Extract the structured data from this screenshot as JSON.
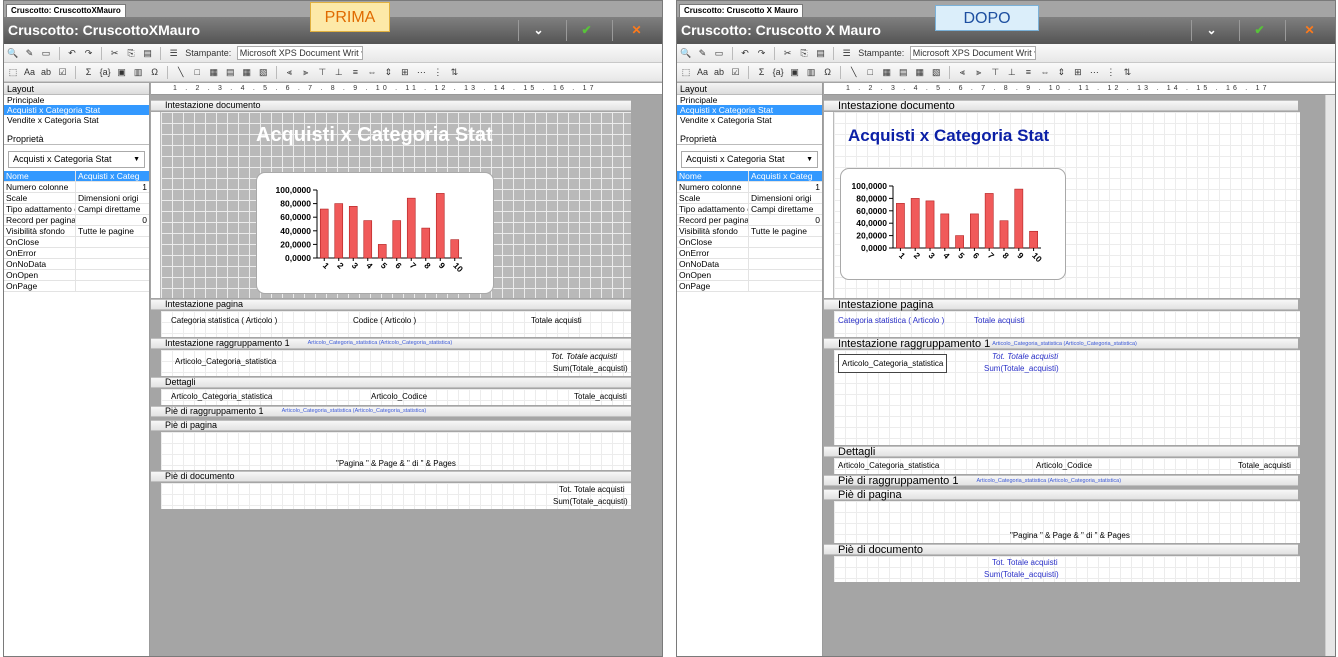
{
  "before": {
    "tab": "Cruscotto: CruscottoXMauro",
    "title": "Cruscotto: CruscottoXMauro",
    "annotation": "PRIMA",
    "printer_label": "Stampante:",
    "printer_value": "Microsoft XPS Document Writ",
    "layout_header": "Layout",
    "layouts": [
      "Principale",
      "Acquisti x Categoria Stat",
      "Vendite x Categoria Stat"
    ],
    "props_header": "Proprietà",
    "props_select": "Acquisti x Categoria Stat",
    "properties": [
      {
        "name": "Nome",
        "value": "Acquisti x Categ"
      },
      {
        "name": "Numero colonne",
        "value": "1"
      },
      {
        "name": "Scale",
        "value": "Dimensioni origi"
      },
      {
        "name": "Tipo adattamento c",
        "value": "Campi direttame"
      },
      {
        "name": "Record per pagina",
        "value": "0"
      },
      {
        "name": "Visibilità sfondo",
        "value": "Tutte le pagine"
      },
      {
        "name": "OnClose",
        "value": ""
      },
      {
        "name": "OnError",
        "value": ""
      },
      {
        "name": "OnNoData",
        "value": ""
      },
      {
        "name": "OnOpen",
        "value": ""
      },
      {
        "name": "OnPage",
        "value": ""
      }
    ],
    "ruler": "1 . 2 . 3 . 4 . 5 . 6 . 7 . 8 . 9 . 10 . 11 . 12 . 13 . 14 . 15 . 16 . 17",
    "bands": {
      "doc_header": "Intestazione documento",
      "page_header": "Intestazione pagina",
      "group_header": "Intestazione raggruppamento 1",
      "group_expr": "Articolo_Categoria_statistica (Articolo_Categoria_statistica)",
      "details": "Dettagli",
      "group_footer": "Piè di raggruppamento 1",
      "page_footer": "Piè di pagina",
      "doc_footer": "Piè di documento"
    },
    "report_title": "Acquisti x Categoria Stat",
    "col_cat": "Categoria statistica ( Articolo )",
    "col_code": "Codice ( Articolo )",
    "col_total": "Totale acquisti",
    "group_field": "Articolo_Categoria_statistica",
    "tot_label": "Tot. Totale acquisti",
    "sum_expr": "Sum(Totale_acquisti)",
    "detail_cat": "Articolo_Categoria_statistica",
    "detail_code": "Articolo_Codice",
    "detail_total": "Totale_acquisti",
    "page_expr": "\"Pagina \" & Page & \" di \" & Pages"
  },
  "after": {
    "tab": "Cruscotto: Cruscotto X Mauro",
    "title": "Cruscotto: Cruscotto X Mauro",
    "annotation": "DOPO",
    "printer_label": "Stampante:",
    "printer_value": "Microsoft XPS Document Writ",
    "layout_header": "Layout",
    "layouts": [
      "Principale",
      "Acquisti x Categoria Stat",
      "Vendite x Categoria Stat"
    ],
    "props_header": "Proprietà",
    "props_select": "Acquisti x Categoria Stat",
    "properties": [
      {
        "name": "Nome",
        "value": "Acquisti x Categ"
      },
      {
        "name": "Numero colonne",
        "value": "1"
      },
      {
        "name": "Scale",
        "value": "Dimensioni origi"
      },
      {
        "name": "Tipo adattamento c",
        "value": "Campi direttame"
      },
      {
        "name": "Record per pagina",
        "value": "0"
      },
      {
        "name": "Visibilità sfondo",
        "value": "Tutte le pagine"
      },
      {
        "name": "OnClose",
        "value": ""
      },
      {
        "name": "OnError",
        "value": ""
      },
      {
        "name": "OnNoData",
        "value": ""
      },
      {
        "name": "OnOpen",
        "value": ""
      },
      {
        "name": "OnPage",
        "value": ""
      }
    ],
    "ruler": "1 . 2 . 3 . 4 . 5 . 6 . 7 . 8 . 9 . 10 . 11 . 12 . 13 . 14 . 15 . 16 . 17",
    "bands": {
      "doc_header": "Intestazione documento",
      "page_header": "Intestazione pagina",
      "group_header": "Intestazione raggruppamento 1",
      "group_expr": "Articolo_Categoria_statistica (Articolo_Categoria_statistica)",
      "details": "Dettagli",
      "group_footer": "Piè di raggruppamento 1",
      "page_footer": "Piè di pagina",
      "doc_footer": "Piè di documento"
    },
    "report_title": "Acquisti x Categoria Stat",
    "col_cat": "Categoria statistica ( Articolo )",
    "col_total": "Totale acquisti",
    "group_field": "Articolo_Categoria_statistica",
    "tot_label": "Tot. Totale acquisti",
    "sum_expr": "Sum(Totale_acquisti)",
    "detail_cat": "Articolo_Categoria_statistica",
    "detail_code": "Articolo_Codice",
    "detail_total": "Totale_acquisti",
    "page_expr": "\"Pagina \" & Page & \" di \" & Pages"
  },
  "chart_data": [
    {
      "type": "bar",
      "categories": [
        "1",
        "2",
        "3",
        "4",
        "5",
        "6",
        "7",
        "8",
        "9",
        "10"
      ],
      "values": [
        72000,
        80000,
        76000,
        55000,
        20000,
        55000,
        88000,
        44000,
        95000,
        27000
      ],
      "y_tick_labels": [
        "100,0000",
        "80,0000",
        "60,0000",
        "40,0000",
        "20,0000",
        "0,0000"
      ],
      "ylim": [
        0,
        100000
      ],
      "bar_color": "#f05a5a"
    },
    {
      "type": "bar",
      "categories": [
        "1",
        "2",
        "3",
        "4",
        "5",
        "6",
        "7",
        "8",
        "9",
        "10"
      ],
      "values": [
        72000,
        80000,
        76000,
        55000,
        20000,
        55000,
        88000,
        44000,
        95000,
        27000
      ],
      "y_tick_labels": [
        "100,0000",
        "80,0000",
        "60,0000",
        "40,0000",
        "20,0000",
        "0,0000"
      ],
      "ylim": [
        0,
        100000
      ],
      "bar_color": "#f05a5a"
    }
  ]
}
